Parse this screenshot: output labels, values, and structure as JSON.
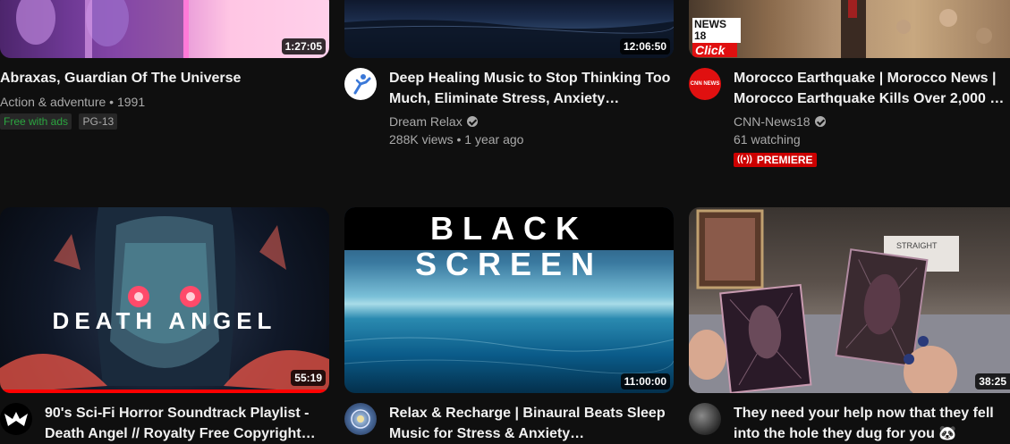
{
  "videos": [
    {
      "title": "Abraxas, Guardian Of The Universe",
      "duration": "1:27:05",
      "genre_year": "Action & adventure • 1991",
      "badges": [
        "Free with ads",
        "PG-13"
      ]
    },
    {
      "title": "Deep Healing Music to Stop Thinking Too Much, Eliminate Stress, Anxiety…",
      "duration": "12:06:50",
      "channel": "Dream Relax",
      "stats": "288K views • 1 year ago"
    },
    {
      "title": "Morocco Earthquake | Morocco News | Morocco Earthquake Kills Over 2,000 …",
      "channel": "CNN-News18",
      "stats": "61 watching",
      "premiere": "PREMIERE",
      "thumb_logo_top": "NEWS 18",
      "thumb_logo_small": "CNN NEWS",
      "thumb_logo_click": "Click"
    },
    {
      "title": "90's Sci-Fi Horror Soundtrack Playlist - Death Angel // Royalty Free Copyright…",
      "duration": "55:19",
      "thumb_text": "DEATH ANGEL",
      "watch_progress": 1.0
    },
    {
      "title": "Relax & Recharge | Binaural Beats Sleep Music for Stress & Anxiety…",
      "duration": "11:00:00",
      "thumb_text": "BLACK SCREEN"
    },
    {
      "title": "They need your help now that they fell into the hole they dug for you 🐼",
      "duration": "38:25",
      "thumb_sign": "STRAIGHT"
    }
  ],
  "colors": {
    "background": "#0f0f0f",
    "accent_red": "#ff0000",
    "premiere_red": "#cc0000",
    "free_green": "#2ba640"
  }
}
